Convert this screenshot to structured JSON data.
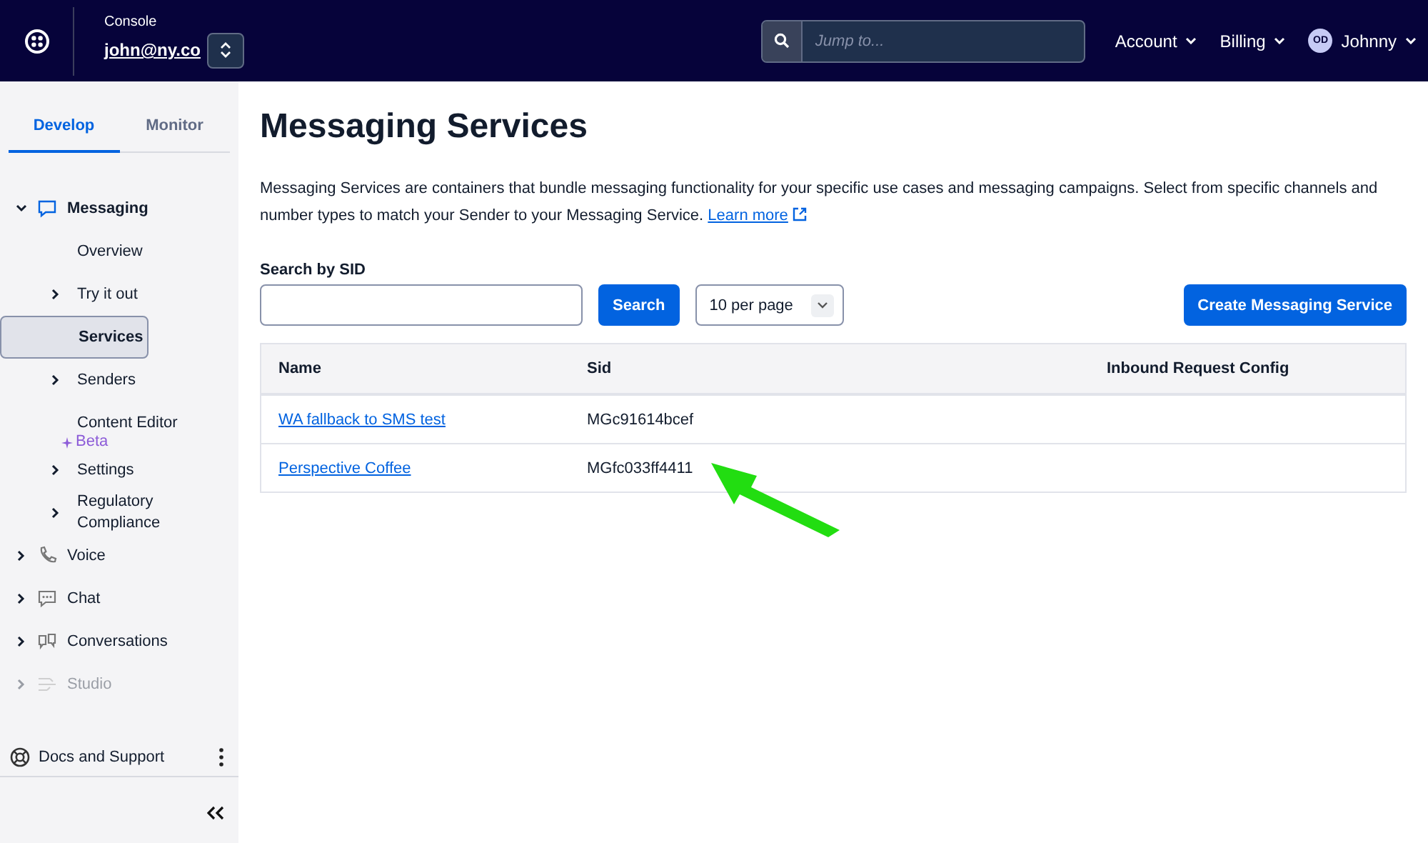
{
  "header": {
    "console_label": "Console",
    "account": "john@ny.co",
    "search": {
      "placeholder": "Jump to..."
    },
    "menus": [
      "Account",
      "Billing"
    ],
    "user": {
      "initials": "OD",
      "name": "Johnny"
    }
  },
  "sidebar": {
    "tabs": [
      {
        "label": "Develop",
        "selected": true
      },
      {
        "label": "Monitor",
        "selected": false
      }
    ],
    "items": [
      {
        "label": "Messaging",
        "kind": "group",
        "expanded": true,
        "selected": false,
        "children": [
          {
            "label": "Overview",
            "kind": "leaf",
            "selected": false
          },
          {
            "label": "Try it out",
            "kind": "group",
            "expanded": false,
            "selected": false
          },
          {
            "label": "Services",
            "kind": "leaf",
            "selected": true
          },
          {
            "label": "Senders",
            "kind": "group",
            "expanded": false,
            "selected": false
          },
          {
            "label": "Content Editor",
            "kind": "leaf",
            "selected": false,
            "badge": "Beta"
          },
          {
            "label": "Settings",
            "kind": "group",
            "expanded": false,
            "selected": false
          },
          {
            "label": "Regulatory Compliance",
            "kind": "group",
            "expanded": false,
            "selected": false
          }
        ]
      },
      {
        "label": "Voice",
        "kind": "group",
        "expanded": false,
        "selected": false
      },
      {
        "label": "Chat",
        "kind": "group",
        "expanded": false,
        "selected": false
      },
      {
        "label": "Conversations",
        "kind": "group",
        "expanded": false,
        "selected": false
      },
      {
        "label": "Studio",
        "kind": "group",
        "expanded": false,
        "selected": false,
        "disabled": true
      }
    ],
    "footer": "Docs and Support"
  },
  "page": {
    "title": "Messaging Services",
    "description": "Messaging Services are containers that bundle messaging functionality for your specific use cases and messaging campaigns. Select from specific channels and number types to match your Sender to your Messaging Service.",
    "learn_more": "Learn more",
    "search_label": "Search by SID",
    "search_button": "Search",
    "page_size": "10 per page",
    "create_button": "Create Messaging Service",
    "table": {
      "columns": [
        "Name",
        "Sid",
        "Inbound Request Config"
      ],
      "rows": [
        {
          "name": "WA fallback to SMS test",
          "sid": "MGc91614bcef"
        },
        {
          "name": "Perspective Coffee",
          "sid": "MGfc033ff4411"
        }
      ]
    }
  }
}
